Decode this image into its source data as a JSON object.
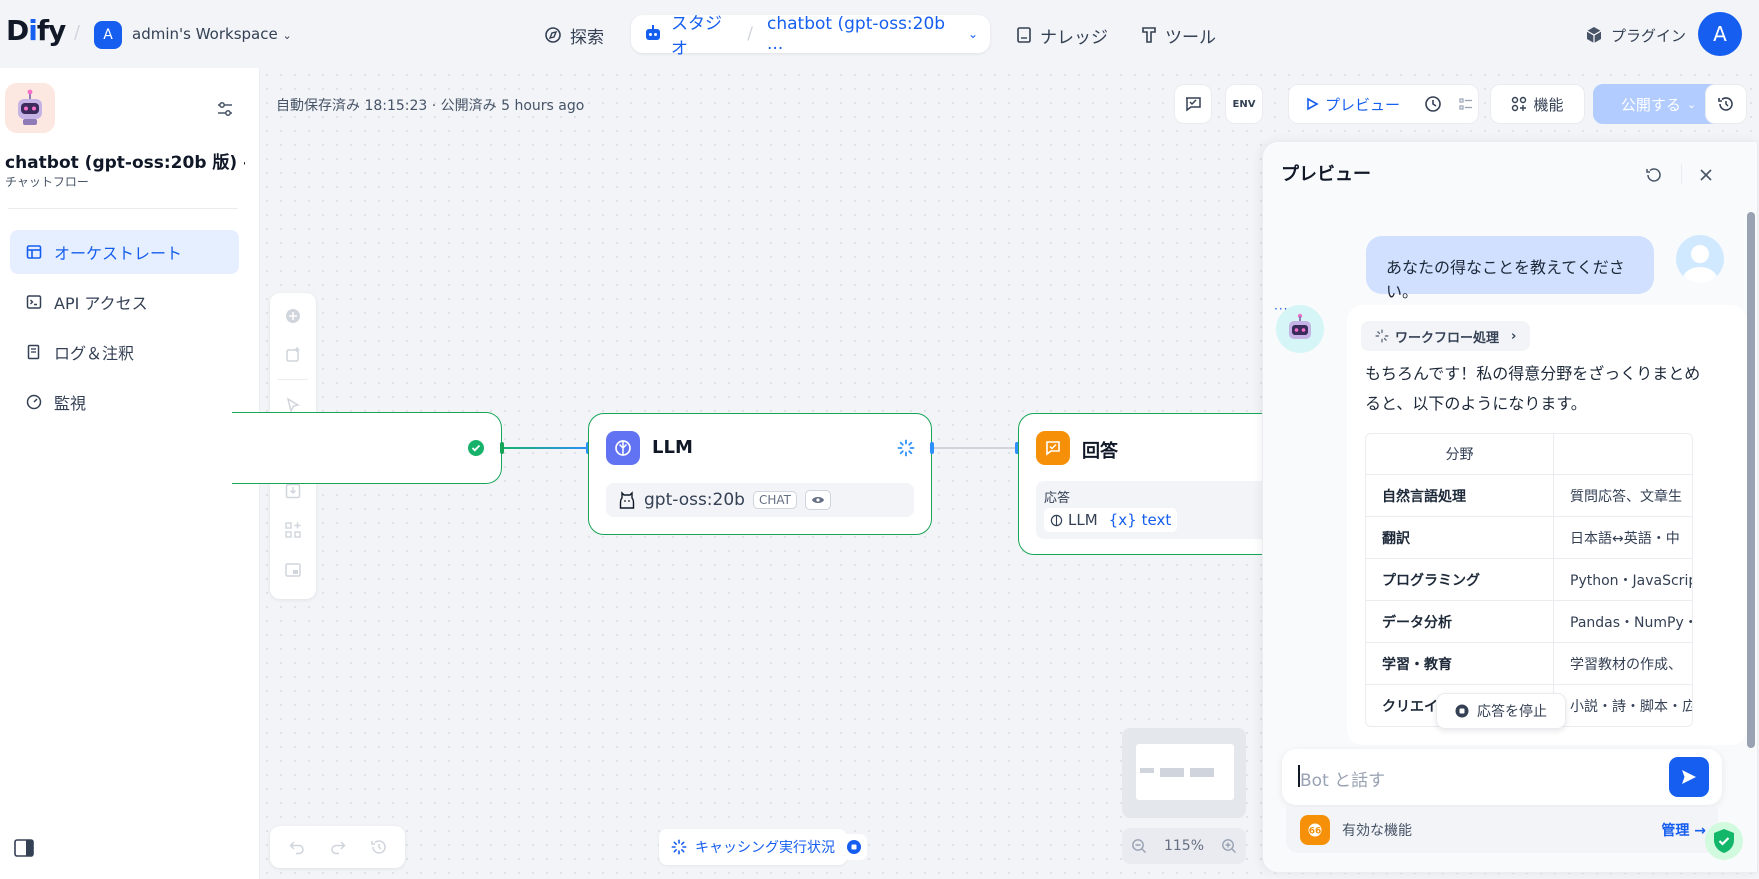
{
  "topbar": {
    "logo": "Dify",
    "workspace_initial": "A",
    "workspace_name": "admin's Workspace",
    "nav_explore": "探索",
    "nav_studio": "スタジオ",
    "nav_app": "chatbot (gpt-oss:20b ...",
    "nav_knowledge": "ナレッジ",
    "nav_tools": "ツール",
    "plugins": "プラグイン",
    "user_initial": "A"
  },
  "sidebar": {
    "app_title": "chatbot (gpt-oss:20b 版) - o...",
    "app_type": "チャットフロー",
    "items": [
      {
        "label": "オーケストレート",
        "icon": "layout-icon"
      },
      {
        "label": "API アクセス",
        "icon": "terminal-icon"
      },
      {
        "label": "ログ＆注釈",
        "icon": "log-icon"
      },
      {
        "label": "監視",
        "icon": "gauge-icon"
      }
    ]
  },
  "canvas": {
    "autosave": "自動保存済み 18:15:23 · 公開済み 5 hours ago",
    "preview_btn": "プレビュー",
    "features_btn": "機能",
    "publish_btn": "公開する",
    "env_label": "ENV",
    "llm_node": {
      "title": "LLM",
      "model": "gpt-oss:20b",
      "badge": "CHAT"
    },
    "answer_node": {
      "title": "回答",
      "field_label": "応答",
      "var_source": "LLM",
      "var_name": "text"
    },
    "run_status": "キャッシング実行状況",
    "zoom": "115%"
  },
  "preview": {
    "title": "プレビュー",
    "user_message": "あなたの得なことを教えてください。",
    "workflow_label": "ワークフロー処理",
    "bot_intro": "もちろんです！私の得意分野をざっくりまとめると、以下のようになります。",
    "table_header": [
      "分野",
      ""
    ],
    "table_rows": [
      [
        "自然言語処理",
        "質問応答、文章生"
      ],
      [
        "翻訳",
        "日本語↔英語・中"
      ],
      [
        "プログラミング",
        "Python・JavaScrip"
      ],
      [
        "データ分析",
        "Pandas・NumPy・M"
      ],
      [
        "学習・教育",
        "学習教材の作成、"
      ],
      [
        "クリエイティブ",
        "小説・詩・脚本・広"
      ]
    ],
    "stop_btn": "応答を停止",
    "input_placeholder": "Bot と話す",
    "features_label": "有効な機能",
    "manage": "管理 →"
  },
  "colors": {
    "accent": "#155eef",
    "success": "#18a558",
    "llm_icon": "#6172f3",
    "answer_icon": "#f79009"
  }
}
